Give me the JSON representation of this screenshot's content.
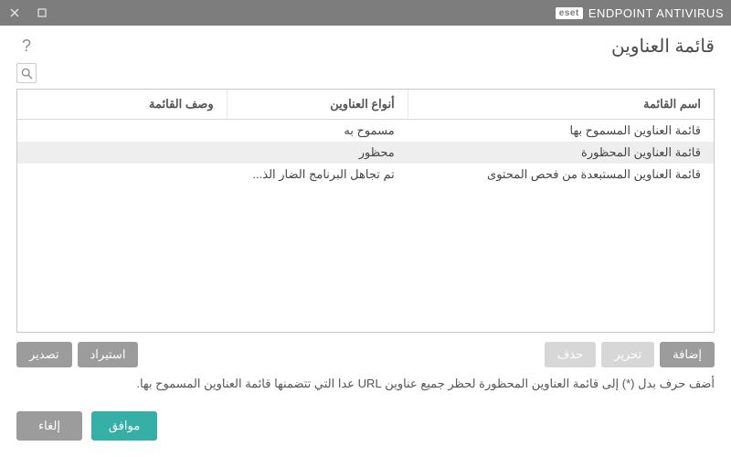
{
  "titlebar": {
    "app_badge": "eset",
    "app_name": "ENDPOINT ANTIVIRUS"
  },
  "header": {
    "title": "قائمة العناوين"
  },
  "columns": {
    "name": "اسم القائمة",
    "type": "أنواع العناوين",
    "desc": "وصف القائمة"
  },
  "rows": [
    {
      "name": "قائمة العناوين المسموح بها",
      "type": "مسموح به",
      "desc": "",
      "selected": false
    },
    {
      "name": "قائمة العناوين المحظورة",
      "type": "محظور",
      "desc": "",
      "selected": true
    },
    {
      "name": "قائمة العناوين المستبعدة من فحص المحتوى",
      "type": "تم تجاهل البرنامج الضار الذ...",
      "desc": "",
      "selected": false
    }
  ],
  "buttons": {
    "add": "إضافة",
    "edit": "تحرير",
    "delete": "حذف",
    "import": "استيراد",
    "export": "تصدير",
    "ok": "موافق",
    "cancel": "إلغاء"
  },
  "hint": "أضف حرف بدل (*) إلى قائمة العناوين المحظورة لحظر جميع عناوين URL عدا التي تتضمنها قائمة العناوين المسموح بها."
}
